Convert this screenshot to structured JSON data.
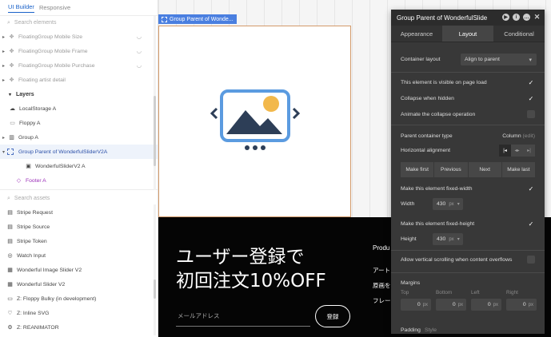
{
  "left_panel": {
    "tabs": [
      "UI Builder",
      "Responsive"
    ],
    "search_elements_placeholder": "Search elements",
    "floating_items": [
      "FloatingGroup Mobile Size",
      "FloatingGroup Mobile Frame",
      "FloatingGroup Mobile Purchase",
      "Floating artist detail"
    ],
    "layers_label": "Layers",
    "layer_items": [
      {
        "label": "LocalStorage A",
        "icon": "cloud-icon"
      },
      {
        "label": "Floppy A",
        "icon": "floppy-icon"
      },
      {
        "label": "Group A",
        "icon": "columns-icon"
      },
      {
        "label": "Group Parent of WonderfulSliderV2A",
        "icon": "group-dashed-icon"
      },
      {
        "label": "WonderfulSliderV2 A",
        "icon": "image-icon"
      },
      {
        "label": "Footer A",
        "icon": "diamond-icon"
      }
    ],
    "search_assets_placeholder": "Search assets",
    "assets": [
      {
        "label": "Stripe Request",
        "icon": "stripe-icon"
      },
      {
        "label": "Stripe Source",
        "icon": "stripe-icon"
      },
      {
        "label": "Stripe Token",
        "icon": "stripe-icon"
      },
      {
        "label": "Watch Input",
        "icon": "watch-icon"
      },
      {
        "label": "Wonderful Image Slider V2",
        "icon": "slider-icon"
      },
      {
        "label": "Wonderful Slider V2",
        "icon": "slider-icon"
      },
      {
        "label": "Z: Floppy Bulky (in development)",
        "icon": "floppy-icon"
      },
      {
        "label": "Z: Inline SVG",
        "icon": "heart-icon"
      },
      {
        "label": "Z: REANIMATOR",
        "icon": "gear-icon"
      }
    ]
  },
  "canvas": {
    "group_label": "Group Parent of Wonde...",
    "hero_title_line1": "ユーザー登録で",
    "hero_title_line2": "初回注文10%OFF",
    "email_placeholder": "メールアドレス",
    "signup_button": "登録",
    "side_texts": [
      "Produ",
      "アート",
      "原画を",
      "フレー"
    ]
  },
  "editor": {
    "title": "Group Parent of WonderfulSlide",
    "tabs": [
      "Appearance",
      "Layout",
      "Conditional"
    ],
    "active_tab": "Layout",
    "container_layout_label": "Container layout",
    "container_layout_value": "Align to parent",
    "visible_on_load_label": "This element is visible on page load",
    "visible_on_load": true,
    "collapse_hidden_label": "Collapse when hidden",
    "collapse_hidden": true,
    "animate_collapse_label": "Animate the collapse operation",
    "animate_collapse": false,
    "parent_type_label": "Parent container type",
    "parent_type_value": "Column",
    "parent_type_edit": "(edit)",
    "horizontal_alignment_label": "Horizontal alignment",
    "nav_buttons": [
      "Make first",
      "Previous",
      "Next",
      "Make last"
    ],
    "fixed_width_label": "Make this element fixed-width",
    "fixed_width": true,
    "width_label": "Width",
    "width_value": "430",
    "width_unit": "px",
    "fixed_height_label": "Make this element fixed-height",
    "fixed_height": true,
    "height_label": "Height",
    "height_value": "430",
    "height_unit": "px",
    "vertical_scroll_label": "Allow vertical scrolling when content overflows",
    "vertical_scroll": false,
    "margins_label": "Margins",
    "margin_sides": [
      "Top",
      "Bottom",
      "Left",
      "Right"
    ],
    "margin_values": [
      "0",
      "0",
      "0",
      "0"
    ],
    "margin_unit": "px",
    "padding_label": "Padding",
    "padding_style": "Style"
  },
  "colors": {
    "accent": "#1a62c9",
    "selection_label": "#4a7fe0",
    "editor_bg": "#383838",
    "footer_bg": "#050505",
    "image_blue": "#5b9be0",
    "image_dark": "#2d3e57",
    "image_sun": "#f2b84b"
  }
}
